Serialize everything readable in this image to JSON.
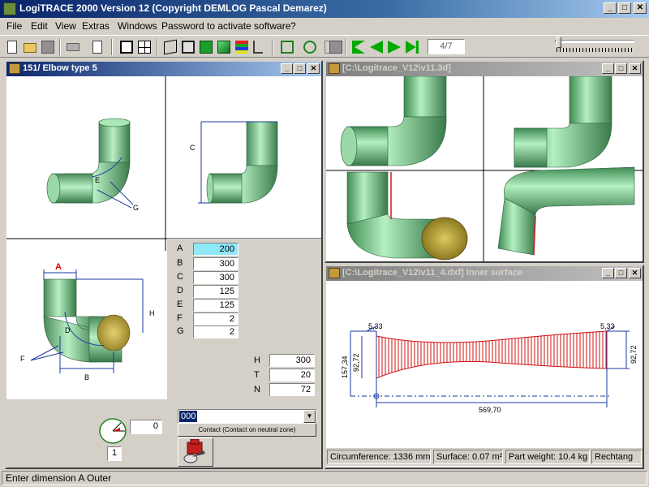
{
  "app": {
    "title": "LogiTRACE 2000  Version 12  (Copyright DEMLOG Pascal Demarez)",
    "minimize": "_",
    "maximize": "□",
    "close": "✕"
  },
  "menu": [
    "File",
    "Edit",
    "View",
    "Extras",
    "Windows",
    "Password to activate software",
    "?"
  ],
  "toolbar": {
    "page_indicator": "4/7",
    "icons": [
      "new-file-icon",
      "open-folder-icon",
      "save-icon",
      "print-icon",
      "copy-icon",
      "front-view-icon",
      "four-views-icon",
      "wireframe-box-icon",
      "outline-box-icon",
      "solid-box-icon",
      "shaded-box-icon",
      "color-bands-icon",
      "tree-icon",
      "clip-icon",
      "rotate-icon",
      "help-icon",
      "info-icon",
      "first-page-icon",
      "previous-page-icon",
      "next-page-icon",
      "last-page-icon"
    ]
  },
  "windows": {
    "elbow": {
      "title": "151/ Elbow type 5"
    },
    "view3d": {
      "title": "[C:\\Logitrace_V12\\v11.3d]"
    },
    "surface": {
      "title": "[C:\\Logitrace_V12\\v11_4.dxf]  Inner surface"
    }
  },
  "drawing_labels": {
    "top_left_e": "E",
    "top_left_g": "G",
    "top_right_c": "C",
    "bottom_a": "A",
    "bottom_h": "H",
    "bottom_d": "D",
    "bottom_f": "F",
    "bottom_b": "B"
  },
  "dimensions": [
    {
      "label": "A",
      "value": "200",
      "selected": true
    },
    {
      "label": "B",
      "value": "300"
    },
    {
      "label": "C",
      "value": "300"
    },
    {
      "label": "D",
      "value": "125"
    },
    {
      "label": "E",
      "value": "125"
    },
    {
      "label": "F",
      "value": "2"
    },
    {
      "label": "G",
      "value": "2"
    }
  ],
  "extra_params": [
    {
      "label": "H",
      "value": "300"
    },
    {
      "label": "T",
      "value": "20"
    },
    {
      "label": "N",
      "value": "72"
    }
  ],
  "angle": {
    "value": "0",
    "count": "1"
  },
  "contact": {
    "combo_value": "000",
    "button_label": "Contact (Contact on neutral zone)"
  },
  "development": {
    "top_left": "5,33",
    "top_right": "5,33",
    "left_outer": "157,34",
    "left_inner": "92,72",
    "right": "92,72",
    "bottom": "569,70"
  },
  "info": {
    "circumference": "Circumference: 1336 mm",
    "surface": "Surface: 0.07 m²",
    "weight": "Part weight: 10.4 kg",
    "shape": "Rechtang"
  },
  "status": "Enter dimension A Outer"
}
